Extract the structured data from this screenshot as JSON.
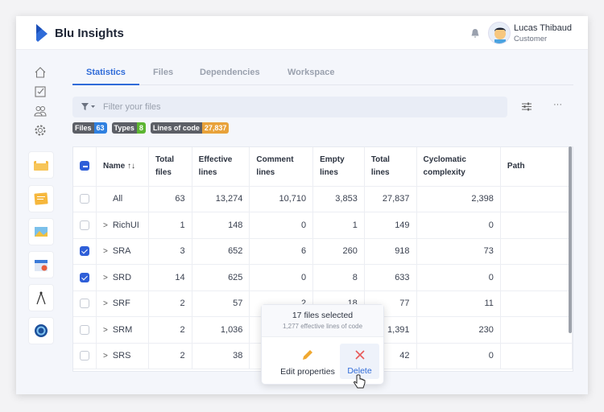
{
  "app": {
    "name": "Blu Insights"
  },
  "user": {
    "name": "Lucas Thibaud",
    "role": "Customer"
  },
  "tabs": [
    {
      "label": "Statistics"
    },
    {
      "label": "Files"
    },
    {
      "label": "Dependencies"
    },
    {
      "label": "Workspace"
    }
  ],
  "filter": {
    "placeholder": "Filter your files",
    "value": ""
  },
  "badges": [
    {
      "key": "Files",
      "value": "63",
      "color": "#2f80e0"
    },
    {
      "key": "Types",
      "value": "8",
      "color": "#5cb531"
    },
    {
      "key": "Lines of code",
      "value": "27,837",
      "color": "#e8a23a"
    }
  ],
  "table": {
    "columns": [
      "Name",
      "Total files",
      "Effective lines",
      "Comment lines",
      "Empty lines",
      "Total lines",
      "Cyclomatic complexity",
      "Path"
    ],
    "rows": [
      {
        "name": "All",
        "checked": false,
        "expandable": false,
        "cells": [
          "63",
          "13,274",
          "10,710",
          "3,853",
          "27,837",
          "2,398",
          ""
        ]
      },
      {
        "name": "RichUI",
        "checked": false,
        "expandable": true,
        "cells": [
          "1",
          "148",
          "0",
          "1",
          "149",
          "0",
          ""
        ]
      },
      {
        "name": "SRA",
        "checked": true,
        "expandable": true,
        "cells": [
          "3",
          "652",
          "6",
          "260",
          "918",
          "73",
          ""
        ]
      },
      {
        "name": "SRD",
        "checked": true,
        "expandable": true,
        "cells": [
          "14",
          "625",
          "0",
          "8",
          "633",
          "0",
          ""
        ]
      },
      {
        "name": "SRF",
        "checked": false,
        "expandable": true,
        "cells": [
          "2",
          "57",
          "2",
          "18",
          "77",
          "11",
          ""
        ]
      },
      {
        "name": "SRM",
        "checked": false,
        "expandable": true,
        "cells": [
          "2",
          "1,036",
          "",
          "",
          "1,391",
          "230",
          ""
        ]
      },
      {
        "name": "SRS",
        "checked": false,
        "expandable": true,
        "cells": [
          "2",
          "38",
          "",
          "",
          "42",
          "0",
          ""
        ]
      }
    ]
  },
  "popup": {
    "title": "17 files selected",
    "subtitle": "1,277 effective lines of code",
    "edit_label": "Edit properties",
    "delete_label": "Delete"
  }
}
